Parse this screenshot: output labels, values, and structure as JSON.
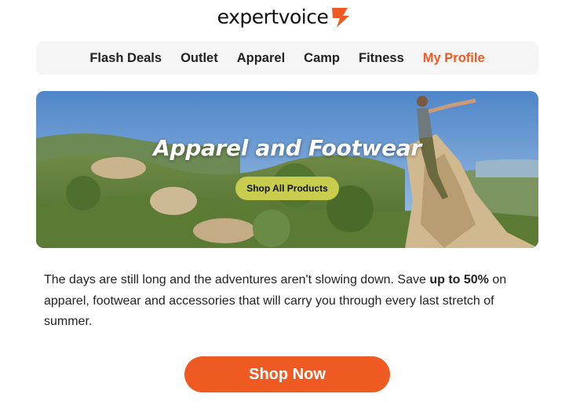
{
  "brand": {
    "name": "expertvoice",
    "accent_color": "#ef5a22",
    "logo_icon": "lightning-bolt-icon"
  },
  "nav": {
    "items": [
      {
        "label": "Flash Deals",
        "active": false
      },
      {
        "label": "Outlet",
        "active": false
      },
      {
        "label": "Apparel",
        "active": false
      },
      {
        "label": "Camp",
        "active": false
      },
      {
        "label": "Fitness",
        "active": false
      },
      {
        "label": "My Profile",
        "active": true
      }
    ]
  },
  "hero": {
    "title": "Apparel and Footwear",
    "button_label": "Shop All Products",
    "button_color": "#c8cd4e"
  },
  "body": {
    "text_before": "The days are still long and the adventures aren't slowing down. Save ",
    "text_bold": "up to 50%",
    "text_after": " on apparel, footwear and accessories that will carry you through every last stretch of summer."
  },
  "cta": {
    "label": "Shop Now",
    "color": "#ef5a22"
  }
}
